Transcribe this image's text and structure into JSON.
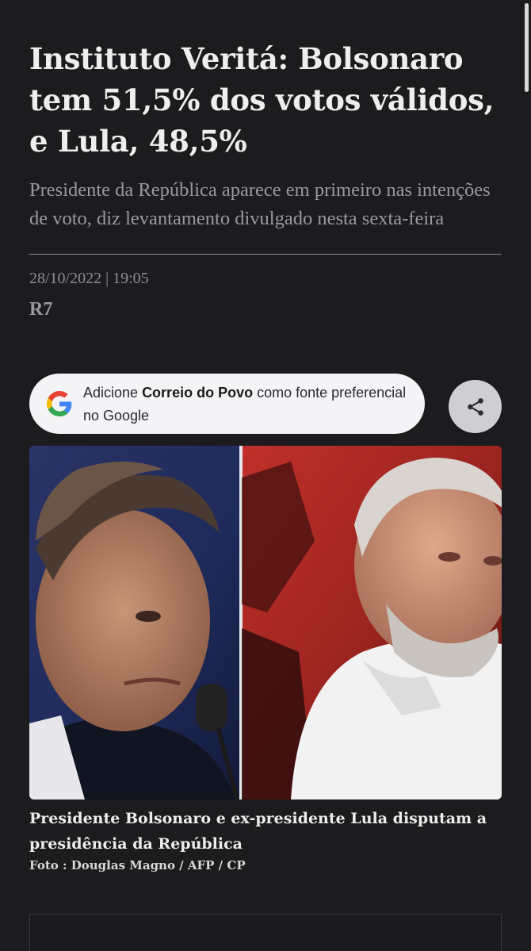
{
  "article": {
    "headline": "Instituto Veritá: Bolsonaro tem 51,5% dos votos válidos, e Lula, 48,5%",
    "subtitle": "Presidente da República aparece em primeiro nas intenções de voto, diz levantamento divulgado nesta sexta-feira",
    "dateline": "28/10/2022 | 19:05",
    "source": "R7"
  },
  "google_prompt": {
    "prefix": "Adicione ",
    "brand": "Correio do Povo",
    "suffix": " como fonte preferencial no Google",
    "icon": "google-g-icon"
  },
  "share": {
    "icon": "share-icon"
  },
  "photo": {
    "caption": "Presidente Bolsonaro e ex-presidente Lula disputam a presidência da República",
    "credit": "Foto : Douglas Magno / AFP / CP"
  },
  "colors": {
    "background": "#1c1c1e",
    "headline": "#eeeeee",
    "muted": "#9a9a9e",
    "pill": "#f4f4f6"
  }
}
